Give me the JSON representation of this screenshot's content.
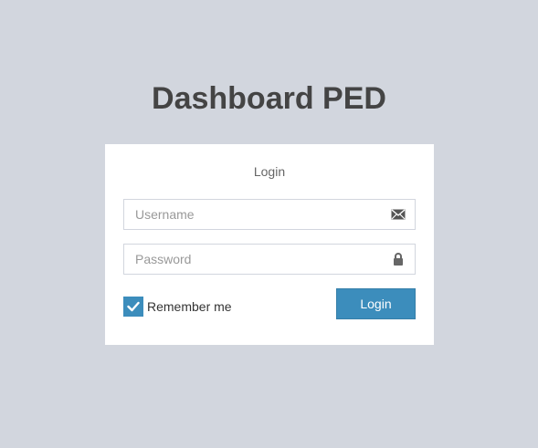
{
  "app": {
    "title": "Dashboard PED"
  },
  "login_box": {
    "title": "Login",
    "username": {
      "value": "",
      "placeholder": "Username",
      "icon": "envelope-icon"
    },
    "password": {
      "value": "",
      "placeholder": "Password",
      "icon": "lock-icon"
    },
    "remember_me": {
      "label": "Remember me",
      "checked": true
    },
    "submit_label": "Login"
  },
  "colors": {
    "background": "#d2d6de",
    "accent": "#3c8dbc",
    "title_text": "#444444"
  }
}
